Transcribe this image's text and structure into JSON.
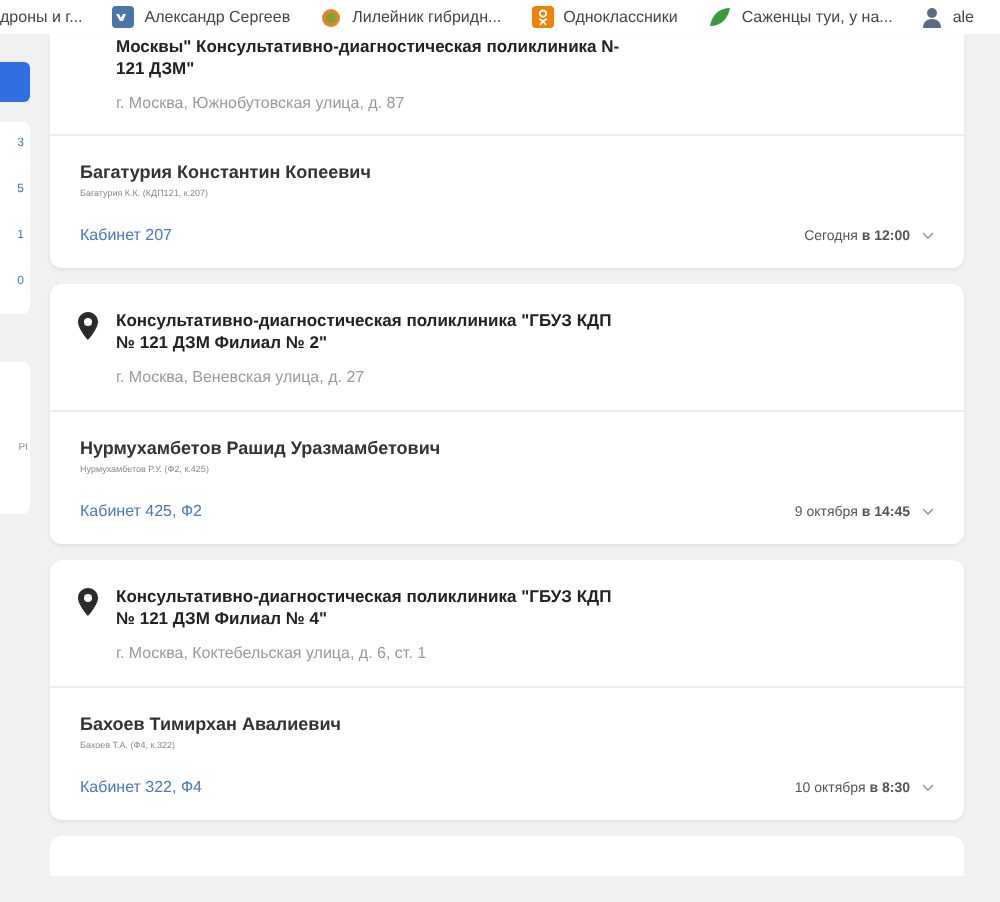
{
  "bookmarks": [
    {
      "label": "дроны и г..."
    },
    {
      "label": "Александр Сергеев"
    },
    {
      "label": "Лилейник гибридн..."
    },
    {
      "label": "Одноклассники"
    },
    {
      "label": "Саженцы туи, у на..."
    },
    {
      "label": "ale"
    }
  ],
  "sidebar": {
    "counts": [
      "3",
      "5",
      "1",
      "0"
    ],
    "note": "PI"
  },
  "appointments": [
    {
      "title_lines": [
        "Москвы\" Консультативно-диагностическая поликлиника N-",
        "121 ДЗМ\""
      ],
      "pin": false,
      "address": "г. Москва, Южнобутовская улица, д. 87",
      "doctor": "Багатурия Константин Копеевич",
      "code": "Багатурия К.К. (КДП121, к.207)",
      "room": "Кабинет 207",
      "when": "Сегодня **в 12:00**"
    },
    {
      "title_lines": [
        "Консультативно-диагностическая поликлиника \"ГБУЗ КДП",
        "№ 121 ДЗМ Филиал № 2\""
      ],
      "pin": true,
      "address": "г. Москва, Веневская улица, д. 27",
      "doctor": "Нурмухамбетов Рашид Уразмамбетович",
      "code": "Нурмухамбетов Р.У. (Ф2, к.425)",
      "room": "Кабинет 425, Ф2",
      "when": "9 октября **в 14:45**"
    },
    {
      "title_lines": [
        "Консультативно-диагностическая поликлиника \"ГБУЗ КДП",
        "№ 121 ДЗМ Филиал № 4\""
      ],
      "pin": true,
      "address": "г. Москва, Коктебельская улица, д. 6, ст. 1",
      "doctor": "Бахоев Тимирхан Авалиевич",
      "code": "Бахоев Т.А. (Ф4, к.322)",
      "room": "Кабинет 322, Ф4",
      "when": "10 октября **в 8:30**"
    }
  ]
}
